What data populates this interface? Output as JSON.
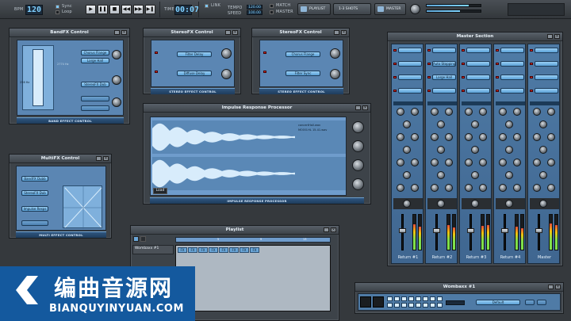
{
  "topbar": {
    "bpm_label": "BPM",
    "bpm_value": "120",
    "sync_label": "Sync",
    "loop_label": "Loop",
    "transport_icons": [
      "play-icon",
      "stop-icon",
      "stop-square-icon",
      "rewind-icon",
      "forward-icon"
    ],
    "time_label": "TIME",
    "time_value": "00:07",
    "link_label": "LINK",
    "tempo_label": "TEMPO",
    "speed_label": "SPEED",
    "tempo_value": "120.00",
    "speed_value": "100.00",
    "match_label": "MATCH",
    "master_label": "MASTER",
    "playlist_button": "PLAYLIST",
    "oneshot_button": "1-3 SHOTS",
    "master_button": "MASTER",
    "levels": [
      0.78,
      0.62
    ]
  },
  "bandfx": {
    "title": "BandFX Control",
    "buttons": [
      "Chorus Flange",
      "Large Hall",
      "StereoFX Dub",
      "",
      ""
    ],
    "freq1": "2774 Hz",
    "freq2": "256 Hz",
    "footer": "BAND EFFECT CONTROL"
  },
  "stereo1": {
    "title": "StereoFX Control",
    "buttons": [
      "Filter Delay",
      "Diffuse Delay"
    ],
    "footer": "STEREO EFFECT CONTROL"
  },
  "stereo2": {
    "title": "StereoFX Control",
    "buttons": [
      "Chorus Flange",
      "Filter Sync"
    ],
    "footer": "STEREO EFFECT CONTROL"
  },
  "impulse": {
    "title": "Impulse Response Processor",
    "file1": "concertHall.wav",
    "file2": "MOOO.HL 15-41.wav",
    "load_button": "Load",
    "footer": "IMPULSE RESPONSE PROCESSOR"
  },
  "multifx": {
    "title": "MultiFX Control",
    "buttons": [
      "BandFX Dubb",
      "StereoFX Dub",
      "Impulse Resps",
      ""
    ],
    "footer": "MULTI EFFECT CONTROL"
  },
  "master": {
    "title": "Master Section",
    "channels": [
      {
        "name": "Return #1",
        "fx": [
          "",
          "",
          "",
          ""
        ],
        "fader": 0.55,
        "vu": [
          0.72,
          0.66
        ]
      },
      {
        "name": "Return #2",
        "fx": [
          "",
          "Auto Stopping",
          "Large Hall",
          ""
        ],
        "fader": 0.55,
        "vu": [
          0.7,
          0.64
        ]
      },
      {
        "name": "Return #3",
        "fx": [
          "",
          "",
          "",
          ""
        ],
        "fader": 0.55,
        "vu": [
          0.68,
          0.7
        ]
      },
      {
        "name": "Return #4",
        "fx": [
          "",
          "",
          "",
          ""
        ],
        "fader": 0.55,
        "vu": [
          0.66,
          0.62
        ]
      },
      {
        "name": "Master",
        "fx": [
          "",
          "",
          "",
          ""
        ],
        "fader": 0.55,
        "vu": [
          0.74,
          0.7
        ]
      }
    ]
  },
  "playlist": {
    "title": "Playlist",
    "track": "Wombaxx #1",
    "markers": [
      "5",
      "9",
      "13"
    ],
    "clips": [
      "FX",
      "FX",
      "FX",
      "FX",
      "FX",
      "FX",
      "FX",
      "FX"
    ]
  },
  "wombaxx": {
    "title": "Wombaxx #1",
    "preset": "Default"
  },
  "logo": {
    "cn": "编曲音源网",
    "url": "BIANQUYINYUAN.COM"
  }
}
